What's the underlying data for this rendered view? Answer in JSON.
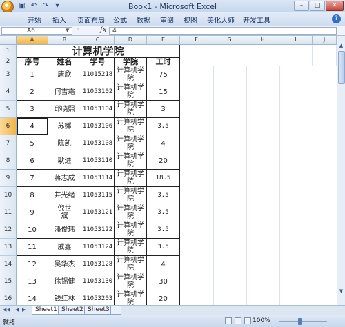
{
  "window": {
    "title": "Book1 - Microsoft Excel"
  },
  "ribbon": {
    "tabs": [
      "开始",
      "插入",
      "页面布局",
      "公式",
      "数据",
      "审阅",
      "视图",
      "美化大师",
      "开发工具"
    ]
  },
  "formula_bar": {
    "cell_ref": "A6",
    "fx": "fx",
    "value": "4"
  },
  "columns": [
    "A",
    "B",
    "C",
    "D",
    "E",
    "F",
    "G",
    "H",
    "I",
    "J"
  ],
  "sheet": {
    "title": "计算机学院",
    "headers": [
      "序号",
      "姓名",
      "学号",
      "学院",
      "工时"
    ],
    "rows": [
      {
        "row": "3",
        "cells": [
          "1",
          "唐欣",
          "11015218",
          "计算机学院",
          "75"
        ]
      },
      {
        "row": "4",
        "cells": [
          "2",
          "何雪霜",
          "11053102",
          "计算机学院",
          "15"
        ]
      },
      {
        "row": "5",
        "cells": [
          "3",
          "邱晓熙",
          "11053104",
          "计算机学院",
          "3"
        ]
      },
      {
        "row": "6",
        "cells": [
          "4",
          "苏娜",
          "11053106",
          "计算机学院",
          "3.5"
        ]
      },
      {
        "row": "7",
        "cells": [
          "5",
          "陈凯",
          "11053108",
          "计算机学院",
          "4"
        ]
      },
      {
        "row": "8",
        "cells": [
          "6",
          "耿进",
          "11053110",
          "计算机学院",
          "20"
        ]
      },
      {
        "row": "9",
        "cells": [
          "7",
          "蒋志成",
          "11053114",
          "计算机学院",
          "18.5"
        ]
      },
      {
        "row": "10",
        "cells": [
          "8",
          "井光绪",
          "11053115",
          "计算机学院",
          "3.5"
        ]
      },
      {
        "row": "11",
        "cells": [
          "9",
          "倪世斌",
          "11053121",
          "计算机学院",
          "3.5"
        ]
      },
      {
        "row": "12",
        "cells": [
          "10",
          "潘俊玮",
          "11053122",
          "计算机学院",
          "3.5"
        ]
      },
      {
        "row": "13",
        "cells": [
          "11",
          "戚鑫",
          "11053124",
          "计算机学院",
          "3.5"
        ]
      },
      {
        "row": "14",
        "cells": [
          "12",
          "吴华杰",
          "11053128",
          "计算机学院",
          "4"
        ]
      },
      {
        "row": "15",
        "cells": [
          "13",
          "徐锡健",
          "11053130",
          "计算机学院",
          "30"
        ]
      },
      {
        "row": "16",
        "cells": [
          "14",
          "钱红林",
          "11053203",
          "计算机学院",
          "20"
        ]
      }
    ]
  },
  "sheet_tabs": [
    "Sheet1",
    "Sheet2",
    "Sheet3"
  ],
  "status": {
    "left": "就绪",
    "zoom": "100%"
  },
  "icons": {
    "office": "office-button-icon",
    "save": "save-icon",
    "undo": "undo-icon",
    "redo": "redo-icon",
    "minimize": "minimize-icon",
    "maximize": "maximize-icon",
    "close": "close-icon",
    "help": "help-icon"
  }
}
